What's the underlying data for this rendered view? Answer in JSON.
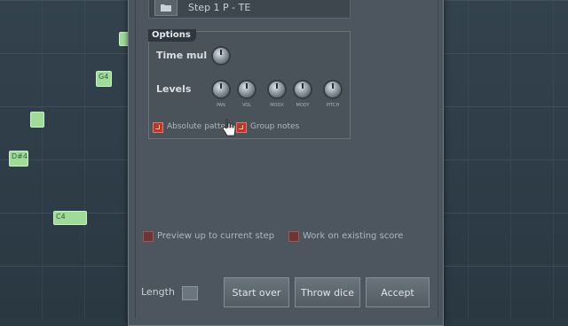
{
  "piano_roll": {
    "notes": [
      {
        "label": ""
      },
      {
        "label": "G4"
      },
      {
        "label": ""
      },
      {
        "label": "D#4"
      },
      {
        "label": "C4"
      }
    ]
  },
  "dialog": {
    "preset_field": "Step 1 P - TE",
    "options_title": "Options",
    "time_mul_label": "Time mul",
    "levels_label": "Levels",
    "knobs": [
      "PAN",
      "VOL",
      "MODX",
      "MODY",
      "PITCH"
    ],
    "absolute_patterns": "Absolute patte",
    "group_notes": "Group notes",
    "preview_label": "Preview up to current step",
    "work_existing_label": "Work on existing score",
    "length_label": "Length",
    "start_over": "Start over",
    "throw_dice": "Throw dice",
    "accept": "Accept"
  },
  "colors": {
    "note": "#9fdc9a",
    "checkbox": "#b8382c",
    "panel": "#4d565e"
  }
}
